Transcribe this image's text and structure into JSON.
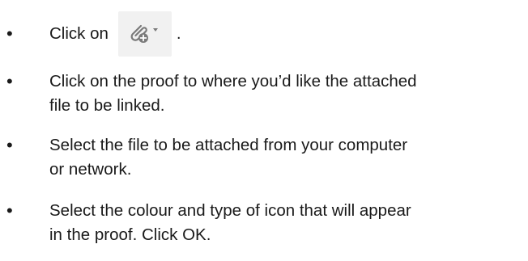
{
  "instructions": {
    "step1": {
      "prefix": "Click on",
      "icon": "attach-file-dropdown-icon",
      "suffix": "."
    },
    "step2": {
      "line1": "Click on the proof to where you’d like the attached",
      "line2": "file to be linked."
    },
    "step3": {
      "line1": "Select the file to be attached from your computer",
      "line2": "or network."
    },
    "step4": {
      "line1": "Select the colour and type of icon that will appear",
      "line2": "in the proof. Click OK."
    }
  },
  "colors": {
    "text": "#1a1a1a",
    "icon_gray": "#7a7a7a",
    "icon_background": "#f1f1f1"
  }
}
